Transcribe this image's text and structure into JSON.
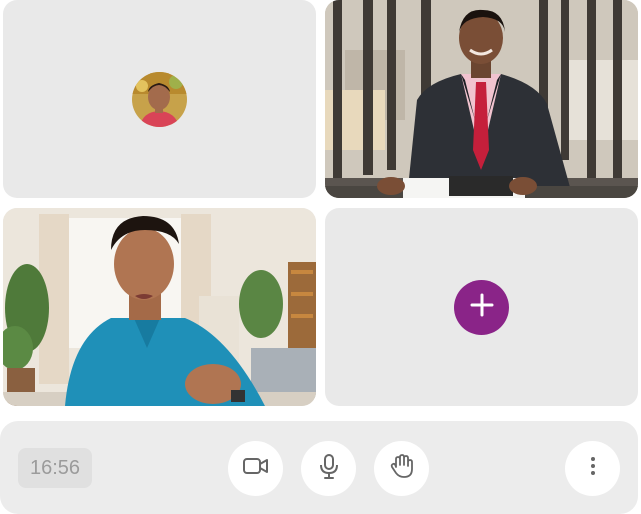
{
  "participants": [
    {
      "tile": 1,
      "video": "off",
      "avatar": "avatar-photo"
    },
    {
      "tile": 2,
      "video": "on"
    },
    {
      "tile": 3,
      "video": "on"
    }
  ],
  "add_tile": {
    "icon": "plus-icon",
    "accent_color": "#8a2488"
  },
  "controls": {
    "clock": "16:56",
    "buttons": [
      {
        "icon": "video-camera-icon"
      },
      {
        "icon": "microphone-icon"
      },
      {
        "icon": "raise-hand-icon"
      },
      {
        "icon": "more-vertical-icon"
      }
    ]
  },
  "colors": {
    "tile_background": "#e9e9e9",
    "bar_background": "#ececec",
    "clock_text": "#9b9b9b"
  }
}
